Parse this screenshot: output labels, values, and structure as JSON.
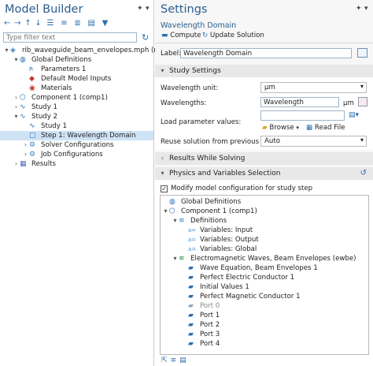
{
  "model_builder": {
    "title": "Model Builder",
    "filter_placeholder": "Type filter text",
    "tree": [
      {
        "label": "rib_waveguide_beam_envelopes.mph (root)",
        "icon": "root-file-icon",
        "depth": 0,
        "toggle": "▾"
      },
      {
        "label": "Global Definitions",
        "icon": "globe-icon",
        "depth": 1,
        "toggle": "▾"
      },
      {
        "label": "Parameters 1",
        "icon": "parameters-icon",
        "depth": 2,
        "toggle": ""
      },
      {
        "label": "Default Model Inputs",
        "icon": "model-inputs-icon",
        "depth": 2,
        "toggle": ""
      },
      {
        "label": "Materials",
        "icon": "materials-icon",
        "depth": 2,
        "toggle": ""
      },
      {
        "label": "Component 1 (comp1)",
        "icon": "component-icon",
        "depth": 1,
        "toggle": "›"
      },
      {
        "label": "Study 1",
        "icon": "study-icon",
        "depth": 1,
        "toggle": "›"
      },
      {
        "label": "Study 2",
        "icon": "study-icon",
        "depth": 1,
        "toggle": "▾"
      },
      {
        "label": "Study 1",
        "icon": "study-step-icon",
        "depth": 2,
        "toggle": ""
      },
      {
        "label": "Step 1: Wavelength Domain",
        "icon": "wavelength-step-icon",
        "depth": 2,
        "toggle": "",
        "selected": true
      },
      {
        "label": "Solver Configurations",
        "icon": "solver-icon",
        "depth": 2,
        "toggle": "›"
      },
      {
        "label": "Job Configurations",
        "icon": "job-icon",
        "depth": 2,
        "toggle": "›"
      },
      {
        "label": "Results",
        "icon": "results-icon",
        "depth": 1,
        "toggle": "›"
      }
    ]
  },
  "settings": {
    "title": "Settings",
    "subtitle": "Wavelength Domain",
    "compute_label": "Compute",
    "update_solution_label": "Update Solution",
    "label_caption": "Label:",
    "label_value": "Wavelength Domain",
    "study_settings": {
      "header": "Study Settings",
      "wavelength_unit_label": "Wavelength unit:",
      "wavelength_unit_value": "µm",
      "wavelengths_label": "Wavelengths:",
      "wavelengths_value": "Wavelength",
      "wavelengths_unit": "µm",
      "load_param_label": "Load parameter values:",
      "browse_label": "Browse",
      "read_file_label": "Read File",
      "reuse_label": "Reuse solution from previous step:",
      "reuse_value": "Auto"
    },
    "results_while_solving": {
      "header": "Results While Solving"
    },
    "physics_selection": {
      "header": "Physics and Variables Selection",
      "modify_label": "Modify model configuration for study step",
      "modify_checked": true,
      "tree": [
        {
          "label": "Global Definitions",
          "icon": "globe-icon",
          "depth": 0,
          "toggle": ""
        },
        {
          "label": "Component 1 (comp1)",
          "icon": "component-icon",
          "depth": 0,
          "toggle": "▾"
        },
        {
          "label": "Definitions",
          "icon": "definitions-icon",
          "depth": 1,
          "toggle": "▾"
        },
        {
          "label": "Variables: Input",
          "icon": "variables-icon",
          "depth": 2,
          "toggle": ""
        },
        {
          "label": "Variables: Output",
          "icon": "variables-icon",
          "depth": 2,
          "toggle": ""
        },
        {
          "label": "Variables: Global",
          "icon": "variables-icon",
          "depth": 2,
          "toggle": ""
        },
        {
          "label": "Electromagnetic Waves, Beam Envelopes (ewbe)",
          "icon": "ewbe-icon",
          "depth": 1,
          "toggle": "▾"
        },
        {
          "label": "Wave Equation, Beam Envelopes 1",
          "icon": "wave-eq-icon",
          "depth": 2,
          "toggle": ""
        },
        {
          "label": "Perfect Electric Conductor 1",
          "icon": "pec-icon",
          "depth": 2,
          "toggle": ""
        },
        {
          "label": "Initial Values 1",
          "icon": "initial-values-icon",
          "depth": 2,
          "toggle": ""
        },
        {
          "label": "Perfect Magnetic Conductor 1",
          "icon": "pmc-icon",
          "depth": 2,
          "toggle": ""
        },
        {
          "label": "Port 0",
          "icon": "port-icon",
          "depth": 2,
          "toggle": "",
          "disabled": true
        },
        {
          "label": "Port 1",
          "icon": "port-icon",
          "depth": 2,
          "toggle": ""
        },
        {
          "label": "Port 2",
          "icon": "port-icon",
          "depth": 2,
          "toggle": ""
        },
        {
          "label": "Port 3",
          "icon": "port-icon",
          "depth": 2,
          "toggle": ""
        },
        {
          "label": "Port 4",
          "icon": "port-icon",
          "depth": 2,
          "toggle": ""
        }
      ]
    }
  },
  "colors": {
    "accent": "#2a5d8f",
    "selection": "#cfe3f5",
    "section_header": "#e8e8e8"
  }
}
